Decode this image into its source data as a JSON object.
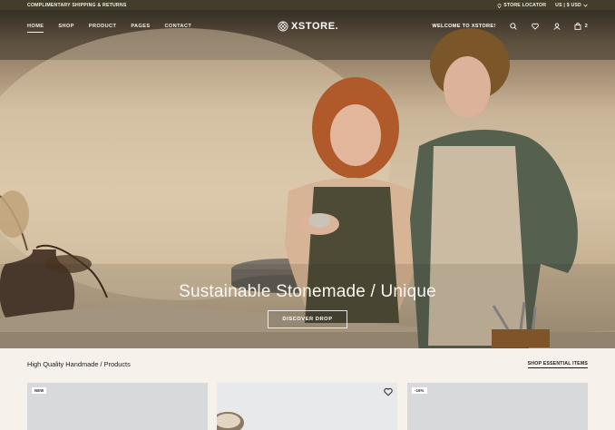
{
  "topbar": {
    "promo": "COMPLIMENTARY SHIPPING & RETURNS",
    "store_locator": "STORE LOCATOR",
    "currency": "US | $ USD"
  },
  "nav": {
    "links": [
      "HOME",
      "SHOP",
      "PRODUCT",
      "PAGES",
      "CONTACT"
    ],
    "logo": "XSTORE.",
    "welcome": "WELCOME TO XSTORE!",
    "cart_count": "2"
  },
  "hero": {
    "title": "Sustainable Stonemade / Unique",
    "button": "DISCOVER DROP"
  },
  "products": {
    "title": "High Quality Handmade / Products",
    "link": "SHOP ESSENTIAL ITEMS",
    "badges": [
      "NEW",
      "-15%"
    ]
  },
  "colors": {
    "topbar": "#433d2c",
    "page_bg": "#f6f1ea"
  }
}
